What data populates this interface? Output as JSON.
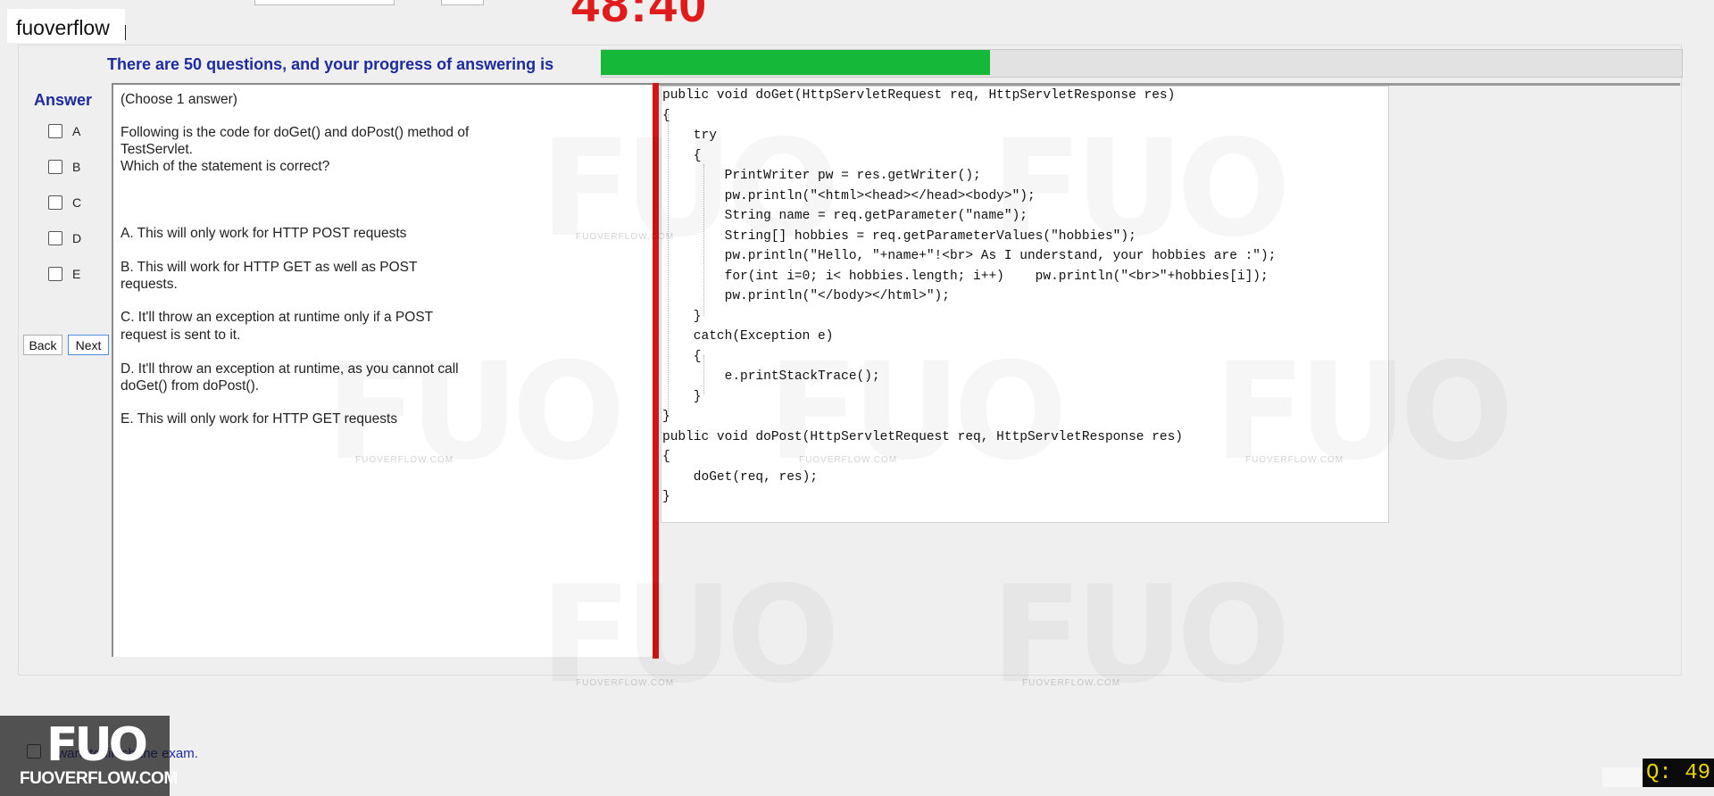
{
  "app": {
    "brand": "fuoverflow",
    "timer": "48:40"
  },
  "progress": {
    "label": "There are 50 questions, and your progress of answering is",
    "fraction": 0.36,
    "color": "#16b83a"
  },
  "answer_panel": {
    "title": "Answer",
    "options": [
      "A",
      "B",
      "C",
      "D",
      "E"
    ]
  },
  "nav": {
    "back_label": "Back",
    "next_label": "Next"
  },
  "question": {
    "instruction": "(Choose 1 answer)",
    "stem_line1": "Following is the code for doGet() and doPost() method of",
    "stem_line2": "TestServlet.",
    "stem_line3": "Which of the statement is correct?",
    "choice_a": "A.  This will only work for HTTP POST requests",
    "choice_b_1": "B.  This will work for HTTP GET as well as POST",
    "choice_b_2": "requests.",
    "choice_c_1": "C.  It'll throw an exception at runtime only if a POST",
    "choice_c_2": "request is sent to it.",
    "choice_d_1": "D.  It'll throw an exception at runtime, as you cannot call",
    "choice_d_2": "doGet() from doPost().",
    "choice_e": "E.  This will only work for HTTP GET requests"
  },
  "code": {
    "lines": [
      "public void doGet(HttpServletRequest req, HttpServletResponse res)",
      "{",
      "    try",
      "    {",
      "        PrintWriter pw = res.getWriter();",
      "        pw.println(\"<html><head></head><body>\");",
      "        String name = req.getParameter(\"name\");",
      "        String[] hobbies = req.getParameterValues(\"hobbies\");",
      "        pw.println(\"Hello, \"+name+\"!<br> As I understand, your hobbies are :\");",
      "        for(int i=0; i< hobbies.length; i++)    pw.println(\"<br>\"+hobbies[i]);",
      "        pw.println(\"</body></html>\");",
      "    }",
      "    catch(Exception e)",
      "    {",
      "        e.printStackTrace();",
      "    }",
      "}",
      "public void doPost(HttpServletRequest req, HttpServletResponse res)",
      "{",
      "    doGet(req, res);",
      "}"
    ]
  },
  "watermark": {
    "text": "FUO",
    "small_text": "FUOVERFLOW.COM"
  },
  "footer": {
    "finish_label": "I want to finish the exam.",
    "logo_big": "FUO",
    "logo_small": "FUOVERFLOW.COM",
    "question_counter": "Q: 49"
  }
}
